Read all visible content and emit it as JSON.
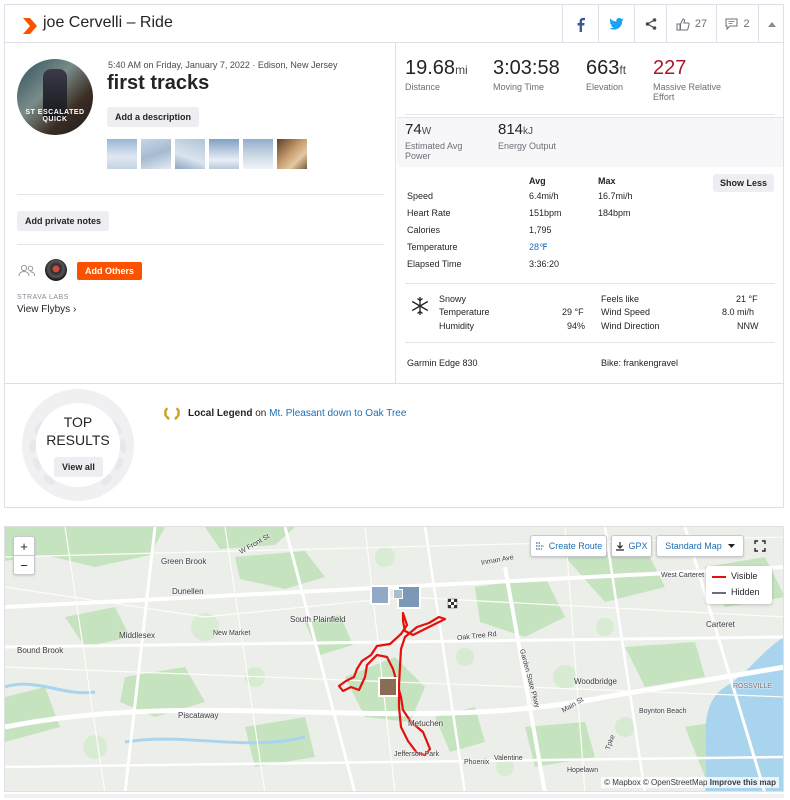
{
  "header": {
    "title": "joe Cervelli – Ride",
    "kudos_count": "27",
    "comment_count": "2"
  },
  "activity": {
    "datetime": "5:40 AM on Friday, January 7, 2022 · Edison, New Jersey",
    "name": "first tracks",
    "add_description": "Add a description",
    "avatar_caption": "ST ESCALATED QUICK",
    "add_private_notes": "Add private notes",
    "add_others": "Add Others",
    "labs": "STRAVA LABS",
    "view_flybys": "View Flybys ›"
  },
  "stats": {
    "distance": {
      "value": "19.68",
      "unit": "mi",
      "label": "Distance"
    },
    "moving_time": {
      "value": "3:03:58",
      "label": "Moving Time"
    },
    "elevation": {
      "value": "663",
      "unit": "ft",
      "label": "Elevation"
    },
    "relative_effort": {
      "value": "227",
      "label": "Massive Relative Effort"
    },
    "power": {
      "value": "74",
      "unit": "W",
      "label": "Estimated Avg Power"
    },
    "energy": {
      "value": "814",
      "unit": "kJ",
      "label": "Energy Output"
    }
  },
  "details": {
    "col_avg": "Avg",
    "col_max": "Max",
    "show_less": "Show Less",
    "rows": [
      {
        "label": "Speed",
        "avg": "6.4mi/h",
        "max": "16.7mi/h"
      },
      {
        "label": "Heart Rate",
        "avg": "151bpm",
        "max": "184bpm"
      },
      {
        "label": "Calories",
        "avg": "1,795",
        "max": ""
      },
      {
        "label": "Temperature",
        "avg": "28℉",
        "max": ""
      },
      {
        "label": "Elapsed Time",
        "avg": "3:36:20",
        "max": ""
      }
    ]
  },
  "weather": {
    "condition": "Snowy",
    "temperature_label": "Temperature",
    "temperature": "29 °F",
    "humidity_label": "Humidity",
    "humidity": "94%",
    "feels_like_label": "Feels like",
    "feels_like": "21 °F",
    "wind_speed_label": "Wind Speed",
    "wind_speed": "8.0 mi/h",
    "wind_dir_label": "Wind Direction",
    "wind_dir": "NNW"
  },
  "device": "Garmin Edge 830",
  "bike": "Bike: frankengravel",
  "results": {
    "top": "TOP",
    "results": "RESULTS",
    "view_all": "View all",
    "legend_bold": "Local Legend",
    "legend_on": " on ",
    "legend_segment": "Mt. Pleasant down to Oak Tree"
  },
  "map": {
    "create_route": "Create Route",
    "gpx": "GPX",
    "map_style": "Standard Map",
    "zoom_in": "+",
    "zoom_out": "−",
    "legend_visible": "Visible",
    "legend_hidden": "Hidden",
    "attribution": "© Mapbox © OpenStreetMap",
    "improve": "Improve this map",
    "places": {
      "green_brook": "Green Brook",
      "dunellen": "Dunellen",
      "middlesex": "Middlesex",
      "new_market": "New Market",
      "bound_brook": "Bound Brook",
      "south_plainfield": "South Plainfield",
      "piscataway": "Piscataway",
      "metuchen": "Metuchen",
      "jefferson_park": "Jefferson Park",
      "phoenix": "Phoenix",
      "valentine": "Valentine",
      "hopelawn": "Hopelawn",
      "woodbridge": "Woodbridge",
      "boynton_beach": "Boynton Beach",
      "carteret": "Carteret",
      "west_carteret": "West Carteret",
      "rossville": "ROSSVILLE",
      "inman_ave": "Inman Ave",
      "oak_tree_rd": "Oak Tree Rd",
      "w_front_st": "W Front St",
      "garden_state_pkwy": "Garden State Pkwy",
      "main_st": "Main St",
      "new_jersey_tpke": "Tpke"
    }
  },
  "colors": {
    "brand": "#fc5200",
    "effort": "#a6192e",
    "link": "#1e6fb4",
    "route": "#e2110e"
  }
}
